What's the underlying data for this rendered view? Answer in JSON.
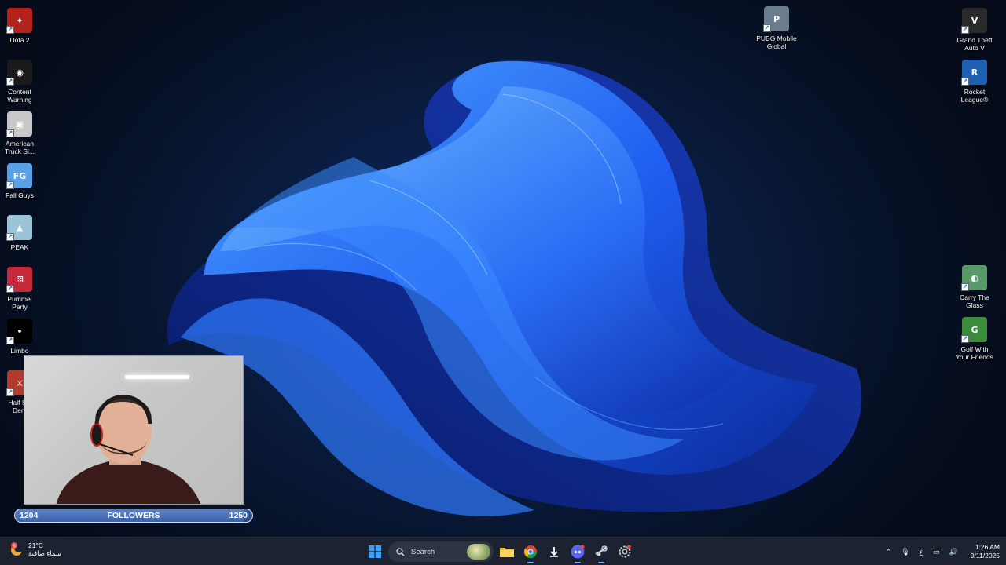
{
  "desktop": {
    "left_icons": [
      {
        "name": "dota2",
        "label": "Dota 2",
        "color": "#b3231c",
        "glyph": "✦"
      },
      {
        "name": "content-warning",
        "label": "Content\nWarning",
        "color": "#1a1a1a",
        "glyph": "◉"
      },
      {
        "name": "american-truck",
        "label": "American\nTruck Si...",
        "color": "#c8c8c8",
        "glyph": "▣"
      },
      {
        "name": "fall-guys",
        "label": "Fall Guys",
        "color": "#5aa0e6",
        "glyph": "FG"
      },
      {
        "name": "peak",
        "label": "PEAK",
        "color": "#9ac4d8",
        "glyph": "▲"
      },
      {
        "name": "pummel-party",
        "label": "Pummel\nParty",
        "color": "#c42a3a",
        "glyph": "⚄"
      },
      {
        "name": "limbo",
        "label": "Limbo",
        "color": "#000000",
        "glyph": "•"
      },
      {
        "name": "half-sword",
        "label": "Half Sw\nDem",
        "color": "#b03a2e",
        "glyph": "⚔"
      }
    ],
    "right_icons": [
      {
        "name": "pubg-mobile",
        "label": "PUBG Mobile\nGlobal",
        "color": "#6b7c8e",
        "glyph": "P"
      },
      {
        "name": "gta5",
        "label": "Grand Theft\nAuto V",
        "color": "#2a2a2a",
        "glyph": "V"
      },
      {
        "name": "rocket-league",
        "label": "Rocket\nLeague®",
        "color": "#1d5fb0",
        "glyph": "R"
      },
      {
        "name": "carry-the-glass",
        "label": "Carry The\nGlass",
        "color": "#5a9a6a",
        "glyph": "◐"
      },
      {
        "name": "golf-with-friends",
        "label": "Golf With\nYour Friends",
        "color": "#3c8a3c",
        "glyph": "G"
      }
    ]
  },
  "stream_overlay": {
    "followers_label": "FOLLOWERS",
    "current": "1204",
    "goal": "1250",
    "progress": 0.963
  },
  "taskbar": {
    "weather": {
      "temp": "21°C",
      "condition": "سماء صافية",
      "badge": "6"
    },
    "search_placeholder": "Search",
    "apps": [
      "windows-start",
      "search",
      "file-explorer",
      "chrome",
      "download-app",
      "discord",
      "steam",
      "settings-app"
    ],
    "tray": {
      "language": "ع",
      "time": "1:26 AM",
      "date": "9/11/2025"
    }
  },
  "colors": {
    "taskbar": "#1c2230",
    "accent": "#0a6cdb",
    "wallpaper_bloom": "#1e6cff"
  }
}
